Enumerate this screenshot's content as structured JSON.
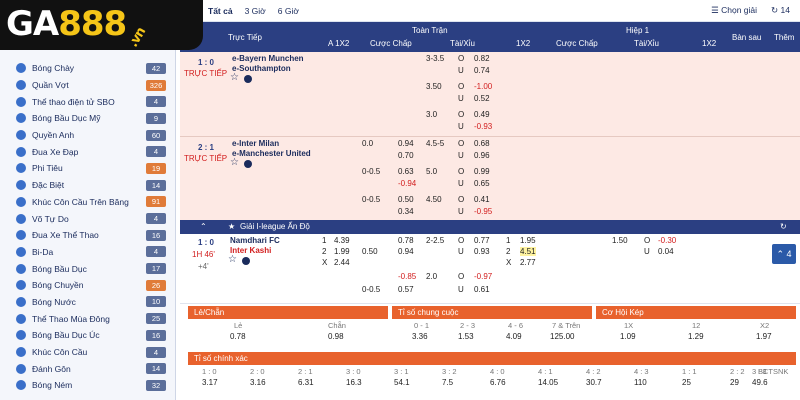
{
  "logo": {
    "prefix": "GA",
    "eights": "888",
    "suffix": ".vn"
  },
  "sports": [
    {
      "name": "Bóng Chày",
      "count": "42"
    },
    {
      "name": "Quần Vợt",
      "count": "326",
      "hl": true
    },
    {
      "name": "Thể thao điện tử SBO",
      "count": "4"
    },
    {
      "name": "Bóng Bầu Dục Mỹ",
      "count": "9"
    },
    {
      "name": "Quyền Anh",
      "count": "60"
    },
    {
      "name": "Đua Xe Đạp",
      "count": "4"
    },
    {
      "name": "Phi Tiêu",
      "count": "19",
      "hl": true
    },
    {
      "name": "Đặc Biệt",
      "count": "14"
    },
    {
      "name": "Khúc Côn Cầu Trên Băng",
      "count": "91",
      "hl": true
    },
    {
      "name": "Võ Tự Do",
      "count": "4"
    },
    {
      "name": "Đua Xe Thể Thao",
      "count": "16"
    },
    {
      "name": "Bi-Da",
      "count": "4"
    },
    {
      "name": "Bóng Bầu Dục",
      "count": "17"
    },
    {
      "name": "Bóng Chuyền",
      "count": "26",
      "hl": true
    },
    {
      "name": "Bóng Nước",
      "count": "10"
    },
    {
      "name": "Thể Thao Mùa Đông",
      "count": "25"
    },
    {
      "name": "Bóng Bầu Dục Úc",
      "count": "16"
    },
    {
      "name": "Khúc Côn Cầu",
      "count": "4"
    },
    {
      "name": "Đánh Gôn",
      "count": "14"
    },
    {
      "name": "Bóng Ném",
      "count": "32"
    }
  ],
  "tabs": {
    "all": "Tất cả",
    "h3": "3 Giờ",
    "h6": "6 Giờ",
    "choose": "Chọn giải",
    "count": "14"
  },
  "header": {
    "live": "Trực Tiếp",
    "full": "Toàn Trận",
    "half": "Hiệp 1",
    "a1x2": "A 1X2",
    "hcp": "Cược Chấp",
    "ou": "Tài/Xỉu",
    "x12": "1X2",
    "hcp2": "Cược Chấp",
    "ou2": "Tài/Xỉu",
    "x12b": "1X2",
    "after": "Bàn sau",
    "more": "Thêm"
  },
  "m1": {
    "score": "1 : 0",
    "status": "TRỰC TIẾP",
    "home": "e-Bayern Munchen",
    "away": "e-Southampton",
    "r1": {
      "ou": "3-3.5",
      "o": "O",
      "ov": "0.82",
      "u": "U",
      "uv": "0.74"
    },
    "r2": {
      "ou": "3.50",
      "o": "O",
      "ov": "-1.00",
      "u": "U",
      "uv": "0.52"
    },
    "r3": {
      "ou": "3.0",
      "o": "O",
      "ov": "0.49",
      "u": "U",
      "uv": "-0.93"
    }
  },
  "m2": {
    "score": "2 : 1",
    "status": "TRỰC TIẾP",
    "home": "e-Inter Milan",
    "away": "e-Manchester United",
    "r1": {
      "h": "0.0",
      "hv": "0.94",
      "av": "0.70",
      "ou": "4.5-5",
      "o": "O",
      "ov": "0.68",
      "u": "U",
      "uv": "0.96"
    },
    "r2": {
      "h": "0-0.5",
      "hv": "0.63",
      "av": "-0.94",
      "ou": "5.0",
      "o": "O",
      "ov": "0.99",
      "u": "U",
      "uv": "0.65"
    },
    "r3": {
      "h": "0-0.5",
      "hv": "0.50",
      "av": "0.34",
      "ou": "4.50",
      "o": "O",
      "ov": "0.41",
      "u": "U",
      "uv": "-0.95"
    }
  },
  "league": {
    "name": "Giải I-league Ấn Độ"
  },
  "m3": {
    "score": "1 : 0",
    "time": "1H 46'",
    "extra": "+4'",
    "home": "Namdhari FC",
    "away": "Inter Kashi",
    "a": {
      "l1": "1",
      "v1": "4.39",
      "l2": "2",
      "v2": "1.99",
      "lx": "X",
      "vx": "2.44"
    },
    "r1": {
      "hv": "0.78",
      "ou": "2-2.5",
      "o": "O",
      "ov": "0.77",
      "l1": "1",
      "x1": "1.95",
      "hh": "1.50",
      "o2": "O",
      "ov2": "-0.30"
    },
    "r2": {
      "h": "0.50",
      "hv": "0.94",
      "u": "U",
      "uv": "0.93",
      "l2": "2",
      "x2": "4.51",
      "u2": "U",
      "uv2": "0.04"
    },
    "r3": {
      "lx": "X",
      "xx": "2.77"
    },
    "r4": {
      "hv": "-0.85",
      "ou": "2.0",
      "o": "O",
      "ov": "-0.97"
    },
    "r5": {
      "h": "0-0.5",
      "hv": "0.57",
      "u": "U",
      "uv": "0.61"
    }
  },
  "oddeven": {
    "title": "Lẻ/Chẵn",
    "l1": "Lẻ",
    "l2": "Chẵn",
    "v1": "0.78",
    "v2": "0.98"
  },
  "totalgoals": {
    "title": "Tỉ số chung cuộc",
    "l": [
      "0 - 1",
      "2 - 3",
      "4 - 6",
      "7 & Trên"
    ],
    "v": [
      "3.36",
      "1.53",
      "4.09",
      "125.00"
    ]
  },
  "double": {
    "title": "Cơ Hội Kép",
    "l": [
      "1X",
      "12",
      "X2"
    ],
    "v": [
      "1.09",
      "1.29",
      "1.97"
    ]
  },
  "correct": {
    "title": "Tỉ số chính xác",
    "l": [
      "1 : 0",
      "2 : 0",
      "2 : 1",
      "3 : 0",
      "3 : 1",
      "3 : 2",
      "4 : 0",
      "4 : 1",
      "4 : 2",
      "4 : 3",
      "1 : 1",
      "2 : 2",
      "3 : 3",
      "4 : 4"
    ],
    "v": [
      "3.17",
      "3.16",
      "6.31",
      "16.3",
      "54.1",
      "7.5",
      "6.76",
      "14.05",
      "30.7",
      "110",
      "25",
      "29",
      "49.6"
    ],
    "last": "BCTSNK"
  }
}
